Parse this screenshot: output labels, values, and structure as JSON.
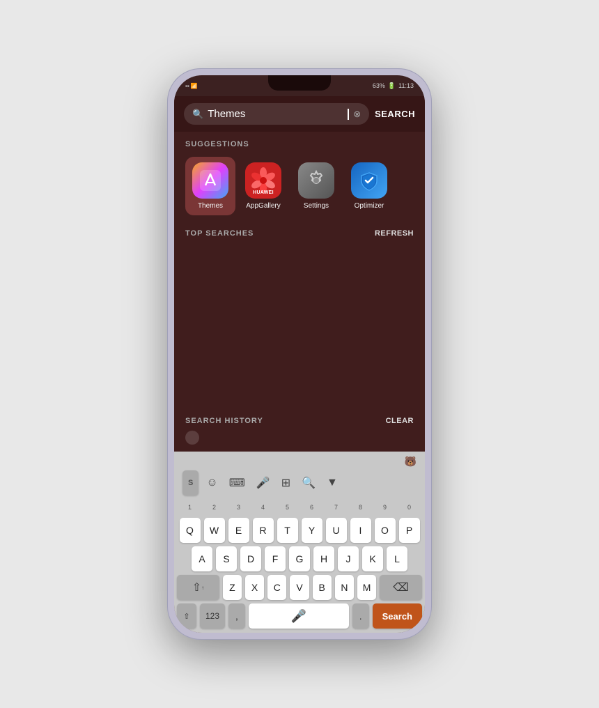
{
  "statusBar": {
    "left": "LTE  .",
    "battery": "63%",
    "time": "11:13"
  },
  "searchBar": {
    "placeholder": "Themes",
    "value": "Themes",
    "searchLabel": "SEARCH",
    "clearIcon": "⊗"
  },
  "suggestions": {
    "title": "SUGGESTIONS",
    "apps": [
      {
        "id": "themes",
        "label": "Themes",
        "selected": true
      },
      {
        "id": "appgallery",
        "label": "AppGallery",
        "selected": false
      },
      {
        "id": "settings",
        "label": "Settings",
        "selected": false
      },
      {
        "id": "optimizer",
        "label": "Optimizer",
        "selected": false
      }
    ]
  },
  "topSearches": {
    "title": "TOP SEARCHES",
    "action": "REFRESH"
  },
  "searchHistory": {
    "title": "SEARCH HISTORY",
    "action": "CLEAR"
  },
  "keyboard": {
    "row1": [
      "Q",
      "W",
      "E",
      "R",
      "T",
      "Y",
      "U",
      "I",
      "O",
      "P"
    ],
    "row1nums": [
      "1",
      "2",
      "3",
      "4",
      "5",
      "6",
      "7",
      "8",
      "9",
      "0"
    ],
    "row2": [
      "A",
      "S",
      "D",
      "F",
      "G",
      "H",
      "J",
      "K",
      "L"
    ],
    "row3": [
      "Z",
      "X",
      "C",
      "V",
      "B",
      "N",
      "M"
    ],
    "searchLabel": "Search",
    "spaceLabel": "",
    "num123": "123",
    "dotLabel": "."
  }
}
